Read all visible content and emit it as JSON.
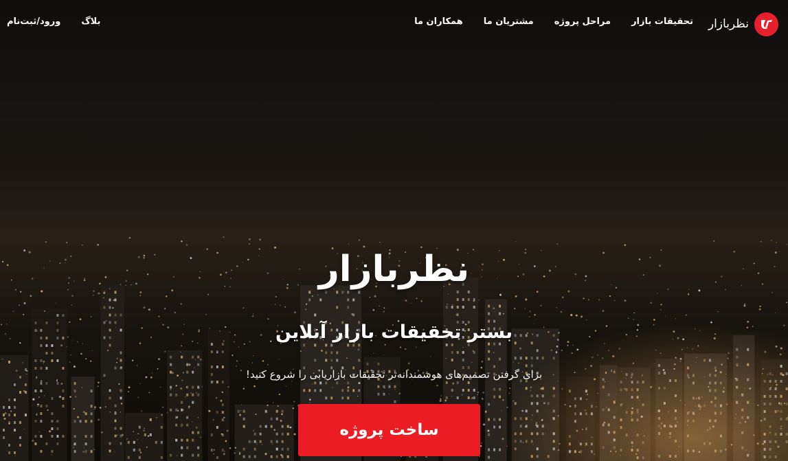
{
  "brand": {
    "name": "نظربازار",
    "logo_icon": "brand-logo-icon",
    "accent_color": "#e8202e"
  },
  "nav": {
    "items": [
      {
        "label": "تحقیقات بازار"
      },
      {
        "label": "مراحل پروژه"
      },
      {
        "label": "مشتریان ما"
      },
      {
        "label": "همکاران ما"
      }
    ],
    "blog_label": "بلاگ",
    "login_label": "ورود/ثبت‌نام"
  },
  "hero": {
    "title": "نظربازار",
    "subtitle": "بستر تحقیقات بازار آنلاین",
    "description": "برای گرفتن تصمیم‌های هوشمندانه‌تر تحقیقات بازاریابی را شروع کنید!",
    "cta_label": "ساخت پروژه",
    "cta_color": "#ec1c24",
    "background": "night-city-skyline-photo"
  }
}
